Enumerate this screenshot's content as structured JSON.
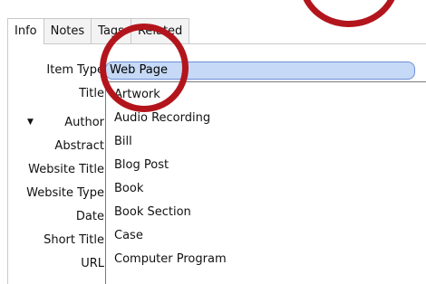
{
  "tabs": {
    "info": "Info",
    "notes": "Notes",
    "tags": "Tags",
    "related": "Related"
  },
  "fields": {
    "item_type": "Item Type",
    "title": "Title",
    "author": "Author",
    "abstract": "Abstract",
    "website_title": "Website Title",
    "website_type": "Website Type",
    "date": "Date",
    "short_title": "Short Title",
    "url": "URL"
  },
  "item_type_value": "Web Page",
  "dropdown_options": {
    "o0": "Artwork",
    "o1": "Audio Recording",
    "o2": "Bill",
    "o3": "Blog Post",
    "o4": "Book",
    "o5": "Book Section",
    "o6": "Case",
    "o7": "Computer Program"
  },
  "colors": {
    "annotation_red": "#b3151d",
    "combo_fill": "#c6d9f6",
    "combo_border": "#6e8fd6"
  },
  "icons": {
    "author_toggle": "triangle-down-icon"
  }
}
